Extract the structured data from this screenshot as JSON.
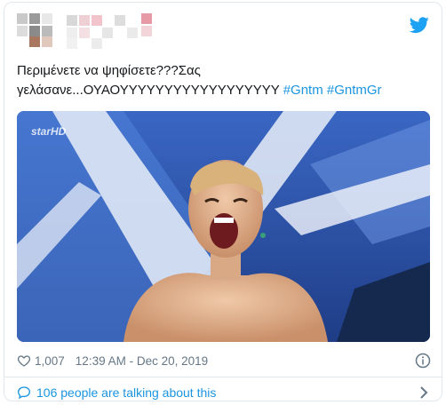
{
  "tweet": {
    "text_line1": "Περιμένετε να ψηφίσετε???Σας",
    "text_line2_prefix": "γελάσανε...ΟΥΑΟΥΥΥΥΥΥΥΥΥΥΥΥΥΥΥΥΥΥ ",
    "hashtags": [
      "#Gntm",
      "#GntmGr"
    ],
    "likes": "1,007",
    "timestamp": "12:39 AM - Dec 20, 2019"
  },
  "media": {
    "channel_logo": "starHD"
  },
  "footer": {
    "talking_label": "106 people are talking about this"
  },
  "colors": {
    "link": "#1b95e0",
    "meta": "#657786",
    "border": "#e1e8ed",
    "studio_blue": "#2d4fa8"
  },
  "icons": [
    "twitter-bird-icon",
    "heart-icon",
    "info-icon",
    "speech-bubble-icon",
    "chevron-right-icon"
  ]
}
